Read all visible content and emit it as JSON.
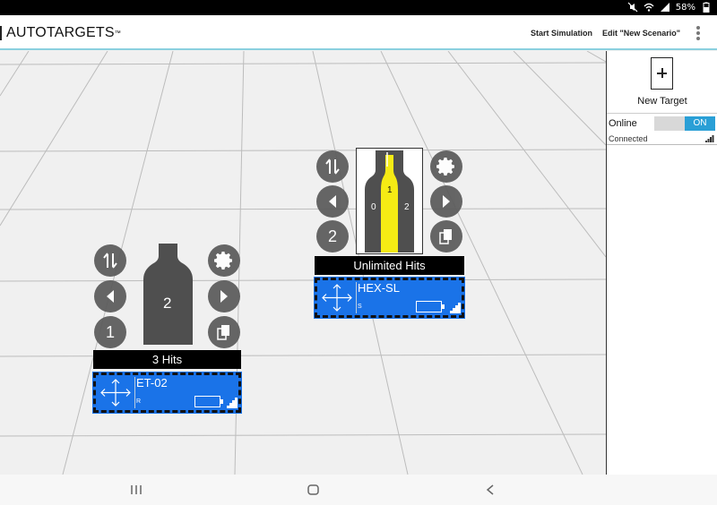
{
  "status_bar": {
    "battery": "58%"
  },
  "app_bar": {
    "logo": "AUTOTARGETS",
    "logo_tm": "™",
    "start_simulation": "Start Simulation",
    "edit_scenario": "Edit \"New Scenario\""
  },
  "panel": {
    "new_target_label": "New Target",
    "device": {
      "status": "Online",
      "toggle": "ON",
      "connection": "Connected"
    }
  },
  "targets": [
    {
      "name": "ET-02",
      "sub": "R",
      "hits": "3 Hits",
      "zone_label": "2",
      "counter": "1"
    },
    {
      "name": "HEX-SL",
      "sub": "S",
      "hits": "Unlimited Hits",
      "zones": [
        "0",
        "1",
        "2"
      ],
      "counter": "2"
    }
  ],
  "colors": {
    "card_blue": "#1a73e8",
    "toggle_on": "#2a9fd6",
    "target_gray": "#4f4f4f",
    "zone_yellow": "#f5eb14",
    "appbar_accent": "#8ad0df"
  },
  "icons": {
    "swap": "swap-arrows-icon",
    "prev": "left-arrow-icon",
    "next": "right-arrow-icon",
    "settings": "gear-icon",
    "copy": "copy-icon",
    "move": "move-arrows-icon",
    "battery": "battery-icon",
    "signal": "signal-icon"
  }
}
